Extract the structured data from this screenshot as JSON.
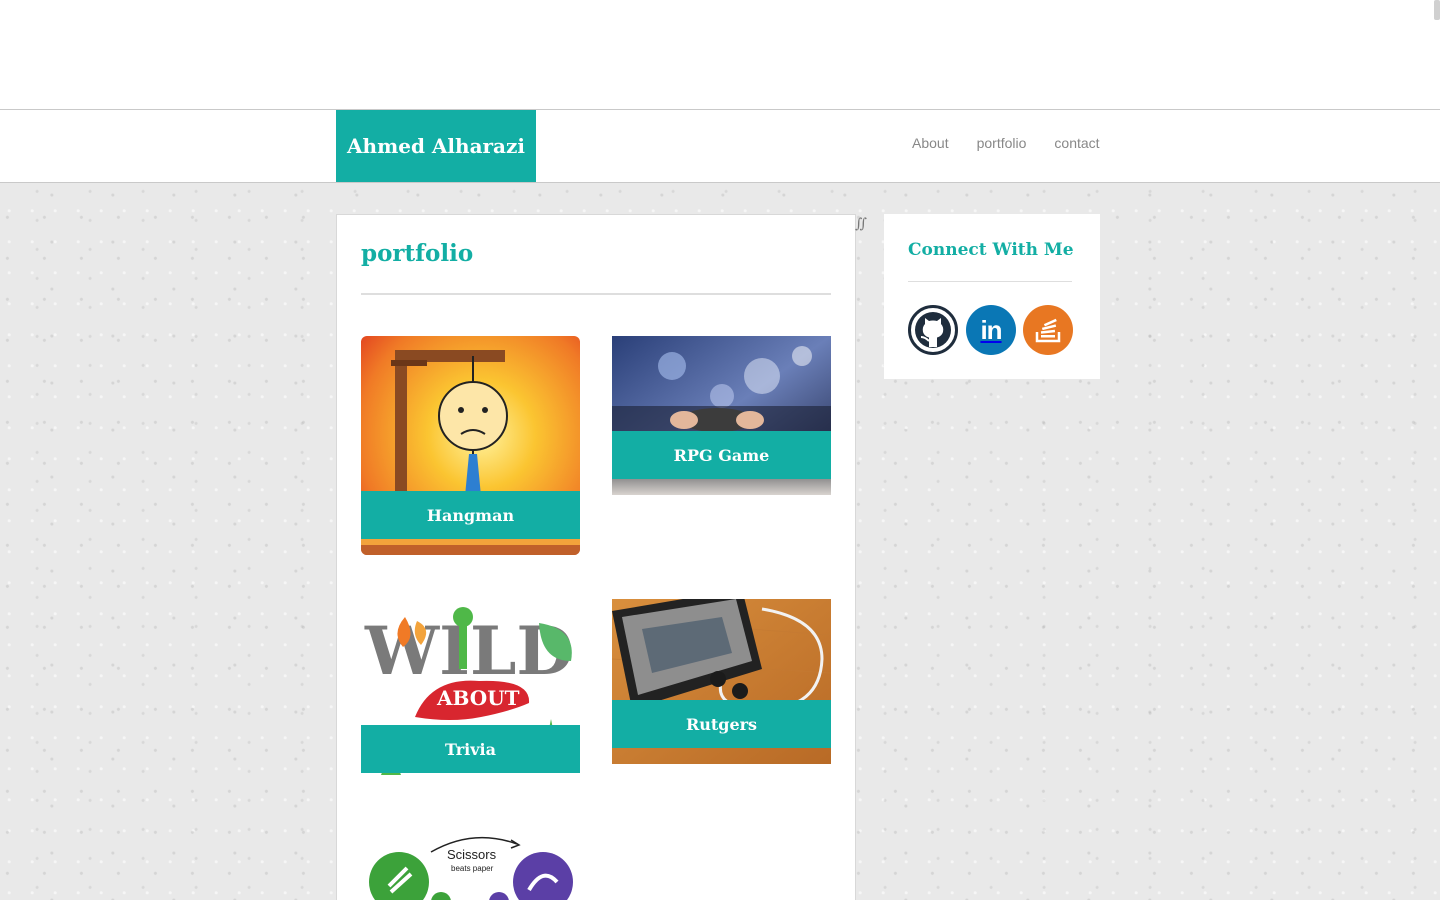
{
  "header": {
    "brand": "Ahmed Alharazi",
    "nav": [
      "About",
      "portfolio",
      "contact"
    ]
  },
  "main": {
    "title": "portfolio",
    "projects": [
      {
        "title": "Hangman",
        "image": "hangman-illustration"
      },
      {
        "title": "RPG Game",
        "image": "game-controller-photo"
      },
      {
        "title": "Trivia",
        "image": "wild-about-trivia-logo"
      },
      {
        "title": "Rutgers",
        "image": "phone-earbuds-photo"
      },
      {
        "title": "",
        "image": "rock-paper-scissors-graphic"
      }
    ],
    "rps_text": {
      "scissors": "Scissors",
      "beats": "beats paper"
    }
  },
  "sidebar": {
    "title": "Connect With Me",
    "social": [
      {
        "name": "github-icon",
        "color": "#1f2d3d"
      },
      {
        "name": "linkedin-icon",
        "color": "#0a77b5"
      },
      {
        "name": "stackoverflow-icon",
        "color": "#e87722"
      }
    ]
  },
  "wild_logo": {
    "wild": "WILD",
    "about": "ABOUT"
  },
  "colors": {
    "accent": "#13aea4",
    "nav_text": "#888888",
    "page_bg": "#e9e9e9"
  }
}
